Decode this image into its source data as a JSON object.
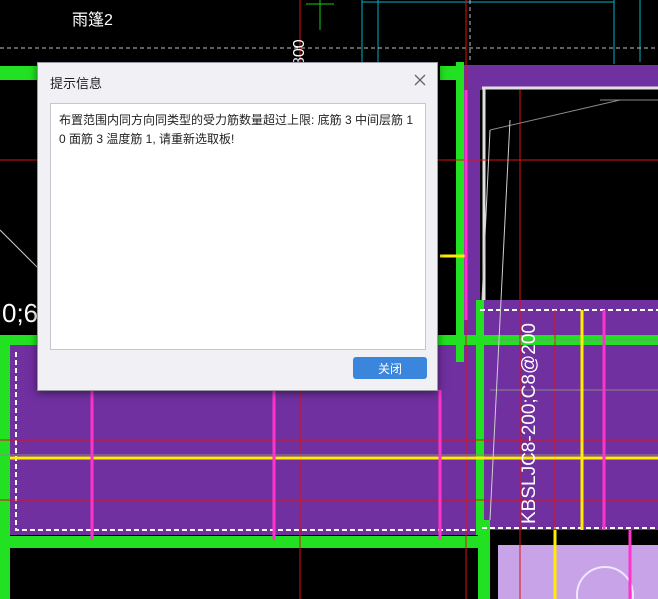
{
  "cad": {
    "top_label": "雨篷2",
    "vertical_dim": "800",
    "left_label": "0;6",
    "rebar_label": "KBSLJC8-200;C8@200"
  },
  "dialog": {
    "title": "提示信息",
    "message": "布置范围内同方向同类型的受力筋数量超过上限: 底筋 3 中间层筋 10 面筋 3 温度筋 1, 请重新选取板!",
    "close_button": "关闭",
    "close_icon": "close-icon"
  },
  "colors": {
    "slab_purple": "#7030a0",
    "green_edge": "#22e022",
    "magenta_rebar": "#ff33cc",
    "yellow_rebar": "#ffee00",
    "red_axis": "#e01010",
    "light_purple": "#c9a3e8",
    "button_blue": "#3a86dc"
  }
}
